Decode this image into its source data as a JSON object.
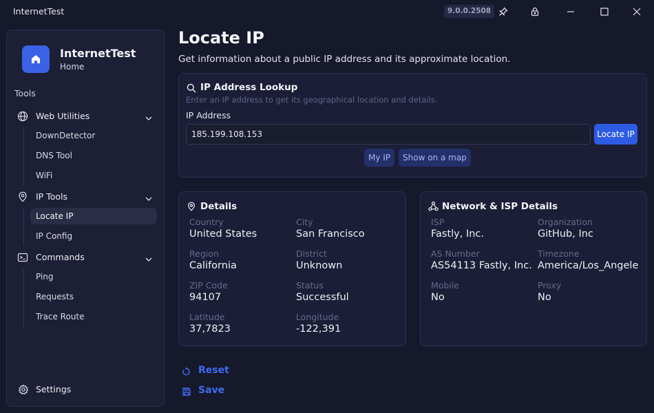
{
  "window": {
    "title": "InternetTest",
    "version": "9.0.0.2508"
  },
  "sidebar": {
    "brand_name": "InternetTest",
    "brand_sub": "Home",
    "tools_label": "Tools",
    "groups": [
      {
        "label": "Web Utilities",
        "icon": "globe-icon",
        "items": [
          "DownDetector",
          "DNS Tool",
          "WiFi"
        ]
      },
      {
        "label": "IP Tools",
        "icon": "location-pin-icon",
        "items": [
          "Locate IP",
          "IP Config"
        ]
      },
      {
        "label": "Commands",
        "icon": "terminal-icon",
        "items": [
          "Ping",
          "Requests",
          "Trace Route"
        ]
      }
    ],
    "active_item": "Locate IP",
    "settings_label": "Settings"
  },
  "page": {
    "title": "Locate IP",
    "description": "Get information about a public IP address and its approximate location."
  },
  "lookup": {
    "title": "IP Address Lookup",
    "subtitle": "Enter an IP address to get its geographical location and details.",
    "field_label": "IP Address",
    "ip_value": "185.199.108.153",
    "locate_button": "Locate IP",
    "my_ip_button": "My IP",
    "map_button": "Show on a map"
  },
  "details": {
    "title": "Details",
    "fields": [
      {
        "label": "Country",
        "value": "United States"
      },
      {
        "label": "City",
        "value": "San Francisco"
      },
      {
        "label": "Region",
        "value": "California"
      },
      {
        "label": "District",
        "value": "Unknown"
      },
      {
        "label": "ZIP Code",
        "value": "94107"
      },
      {
        "label": "Status",
        "value": "Successful"
      },
      {
        "label": "Latitude",
        "value": "37,7823"
      },
      {
        "label": "Longitude",
        "value": "-122,391"
      }
    ]
  },
  "isp": {
    "title": "Network & ISP Details",
    "fields": [
      {
        "label": "ISP",
        "value": "Fastly, Inc."
      },
      {
        "label": "Organization",
        "value": "GitHub, Inc"
      },
      {
        "label": "AS Number",
        "value": "AS54113 Fastly, Inc."
      },
      {
        "label": "Timezone",
        "value": "America/Los_Angeles"
      },
      {
        "label": "Mobile",
        "value": "No"
      },
      {
        "label": "Proxy",
        "value": "No"
      }
    ]
  },
  "actions": {
    "reset_label": "Reset",
    "save_label": "Save"
  },
  "colors": {
    "accent": "#2d5be3",
    "background": "#16182b",
    "card": "#1b1e36"
  }
}
